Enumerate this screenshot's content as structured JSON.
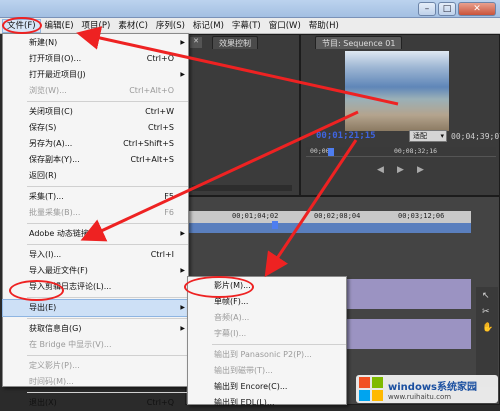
{
  "menubar": {
    "items": [
      {
        "label": "文件(F)",
        "active": true
      },
      {
        "label": "编辑(E)"
      },
      {
        "label": "项目(P)"
      },
      {
        "label": "素材(C)"
      },
      {
        "label": "序列(S)"
      },
      {
        "label": "标记(M)"
      },
      {
        "label": "字幕(T)"
      },
      {
        "label": "窗口(W)"
      },
      {
        "label": "帮助(H)"
      }
    ]
  },
  "panels": {
    "effects_tab": "效果控制",
    "program_tab": "节目: Sequence 01",
    "program_timecode": "00;01;21;15",
    "program_fit": "适配",
    "program_duration": "00;04;39;07",
    "program_ruler_left": "00;00",
    "program_ruler_right": "00;08;32;16",
    "timeline_ruler": [
      "00;01;04;02",
      "00;02;08;04",
      "00;03;12;06"
    ]
  },
  "file_menu": {
    "items": [
      {
        "label": "新建(N)",
        "shortcut": "",
        "submenu": true,
        "disabled": false
      },
      {
        "label": "打开项目(O)...",
        "shortcut": "Ctrl+O",
        "submenu": false,
        "disabled": false
      },
      {
        "label": "打开最近项目(J)",
        "shortcut": "",
        "submenu": true,
        "disabled": false
      },
      {
        "label": "浏览(W)...",
        "shortcut": "Ctrl+Alt+O",
        "submenu": false,
        "disabled": true
      },
      {
        "sep": true
      },
      {
        "label": "关闭项目(C)",
        "shortcut": "Ctrl+W",
        "submenu": false,
        "disabled": false
      },
      {
        "label": "保存(S)",
        "shortcut": "Ctrl+S",
        "submenu": false,
        "disabled": false
      },
      {
        "label": "另存为(A)...",
        "shortcut": "Ctrl+Shift+S",
        "submenu": false,
        "disabled": false
      },
      {
        "label": "保存副本(Y)...",
        "shortcut": "Ctrl+Alt+S",
        "submenu": false,
        "disabled": false
      },
      {
        "label": "返回(R)",
        "shortcut": "",
        "submenu": false,
        "disabled": false
      },
      {
        "sep": true
      },
      {
        "label": "采集(T)...",
        "shortcut": "F5",
        "submenu": false,
        "disabled": false
      },
      {
        "label": "批量采集(B)...",
        "shortcut": "F6",
        "submenu": false,
        "disabled": true
      },
      {
        "sep": true
      },
      {
        "label": "Adobe 动态链接(K)",
        "shortcut": "",
        "submenu": true,
        "disabled": false
      },
      {
        "sep": true
      },
      {
        "label": "导入(I)...",
        "shortcut": "Ctrl+I",
        "submenu": false,
        "disabled": false
      },
      {
        "label": "导入最近文件(F)",
        "shortcut": "",
        "submenu": true,
        "disabled": false
      },
      {
        "label": "导入剪辑日志评论(L)...",
        "shortcut": "",
        "submenu": false,
        "disabled": false
      },
      {
        "sep": true
      },
      {
        "label": "导出(E)",
        "shortcut": "",
        "submenu": true,
        "disabled": false,
        "highlighted": true
      },
      {
        "sep": true
      },
      {
        "label": "获取信息自(G)",
        "shortcut": "",
        "submenu": true,
        "disabled": false
      },
      {
        "label": "在 Bridge 中显示(V)...",
        "shortcut": "",
        "submenu": false,
        "disabled": true
      },
      {
        "sep": true
      },
      {
        "label": "定义影片(P)...",
        "shortcut": "",
        "submenu": false,
        "disabled": true
      },
      {
        "label": "时间码(M)...",
        "shortcut": "",
        "submenu": false,
        "disabled": true
      },
      {
        "sep": true
      },
      {
        "label": "退出(X)",
        "shortcut": "Ctrl+Q",
        "submenu": false,
        "disabled": false
      }
    ]
  },
  "export_menu": {
    "items": [
      {
        "label": "影片(M)...",
        "disabled": false
      },
      {
        "label": "单帧(F)...",
        "disabled": false
      },
      {
        "label": "音频(A)...",
        "disabled": true
      },
      {
        "label": "字幕(I)...",
        "disabled": true
      },
      {
        "sep": true
      },
      {
        "label": "输出到 Panasonic P2(P)...",
        "disabled": true
      },
      {
        "label": "输出到磁带(T)...",
        "disabled": true
      },
      {
        "label": "输出到 Encore(C)...",
        "disabled": false
      },
      {
        "label": "输出到 EDL(L)...",
        "disabled": false
      }
    ]
  },
  "watermark": {
    "brand": "windows系统家园",
    "url": "www.ruihaitu.com"
  },
  "colors": {
    "annotation": "#e22222",
    "timecode_blue": "#3f64e0",
    "menu_highlight": "#cde0f6"
  }
}
